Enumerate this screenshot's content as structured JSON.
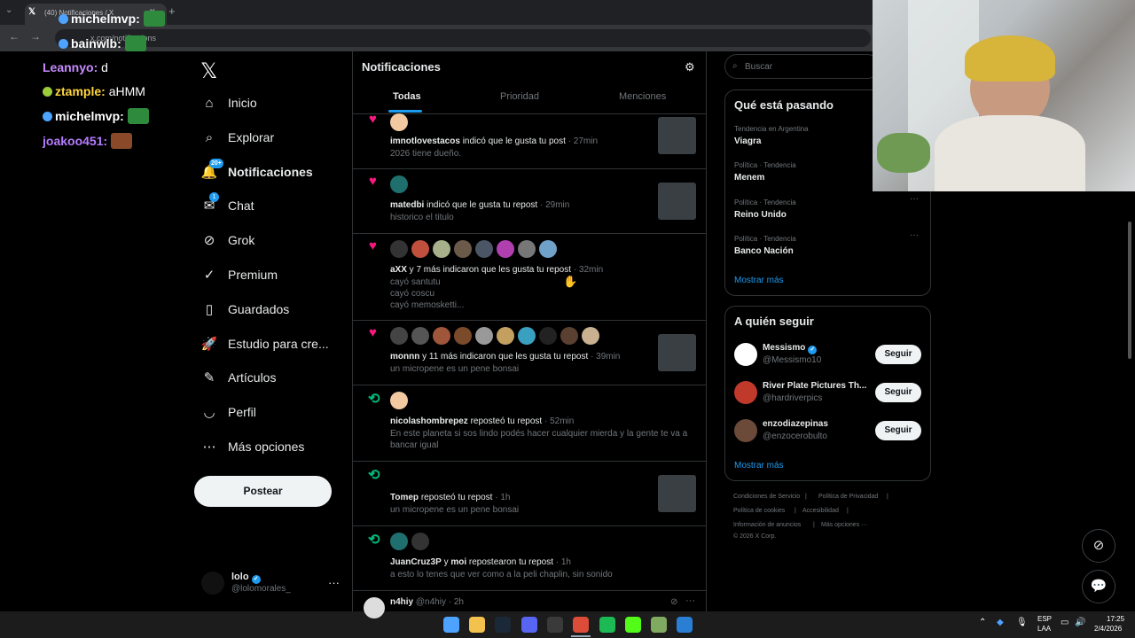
{
  "browser": {
    "tab_title": "(40) Notificaciones / X",
    "url": "x.com/notifications"
  },
  "chat": [
    {
      "user": "michelmvp",
      "sep": ":",
      "text": "",
      "color": "#ffffff"
    },
    {
      "user": "bainwlb",
      "sep": ":",
      "text": "",
      "color": "#ffffff"
    },
    {
      "user": "Leannyo",
      "sep": ": ",
      "text": "d",
      "color": "#c78bff"
    },
    {
      "user": "ztample",
      "sep": ": ",
      "text": "aHMM",
      "color": "#ffd53d"
    },
    {
      "user": "michelmvp",
      "sep": ":",
      "text": "",
      "color": "#ffffff"
    },
    {
      "user": "joakoo451",
      "sep": ":",
      "text": "",
      "color": "#b57cff"
    }
  ],
  "nav": {
    "items": [
      {
        "label": "Inicio",
        "icon": "home-icon"
      },
      {
        "label": "Explorar",
        "icon": "search-icon"
      },
      {
        "label": "Notificaciones",
        "icon": "bell-icon",
        "active": true,
        "badge": "20+"
      },
      {
        "label": "Chat",
        "icon": "chat-icon",
        "badge": "1"
      },
      {
        "label": "Grok",
        "icon": "grok-icon"
      },
      {
        "label": "Premium",
        "icon": "premium-icon"
      },
      {
        "label": "Guardados",
        "icon": "bookmark-icon"
      },
      {
        "label": "Estudio para cre...",
        "icon": "rocket-icon"
      },
      {
        "label": "Artículos",
        "icon": "article-icon"
      },
      {
        "label": "Perfil",
        "icon": "person-icon"
      },
      {
        "label": "Más opciones",
        "icon": "more-circle-icon"
      }
    ],
    "post_label": "Postear",
    "profile_name": "lolo",
    "profile_handle": "@lolomorales_",
    "more": "···"
  },
  "main": {
    "title": "Notificaciones",
    "tabs": [
      "Todas",
      "Prioridad",
      "Menciones"
    ],
    "notifications": [
      {
        "type": "like",
        "user": "imnotlovestacos",
        "action": " indicó que le gusta tu post",
        "time": " · 27min",
        "sub": "2026 tiene dueño."
      },
      {
        "type": "like",
        "user": "matedbi",
        "action": " indicó que le gusta tu repost",
        "time": " · 29min",
        "sub": "historico el titulo"
      },
      {
        "type": "like",
        "user": "aXX",
        "action": " y 7 más indicaron que les gusta tu repost",
        "time": " · 32min",
        "sub": "cayó santutu\ncayó coscu\ncayó memosketti..."
      },
      {
        "type": "like",
        "user": "monnn",
        "action": " y 11 más indicaron que les gusta tu repost",
        "time": " · 39min",
        "sub": "un micropene es un pene bonsai"
      },
      {
        "type": "repost",
        "user": "nicolashombrepez",
        "action": " reposteó tu repost",
        "time": " · 52min",
        "sub": "En este planeta si sos lindo podés hacer cualquier mierda y la gente te va a bancar igual"
      },
      {
        "type": "repost",
        "user": "Tomep",
        "action": " reposteó tu repost",
        "time": " · 1h",
        "sub": "un micropene es un pene bonsai"
      },
      {
        "type": "repost",
        "user": "JuanCruz3P",
        "action": " y ",
        "user2": "moi",
        "action2": " repostearon tu repost",
        "time": " · 1h",
        "sub": "a esto lo tenes que ver como a la peli chaplin, sin sonido"
      },
      {
        "type": "post",
        "user": "n4hiy",
        "action": " @n4hiy",
        "time": " · 2h",
        "sub": ""
      }
    ]
  },
  "right": {
    "search_placeholder": "Buscar",
    "trends_title": "Qué está pasando",
    "trends": [
      {
        "ctx": "Tendencia en Argentina",
        "name": "Viagra"
      },
      {
        "ctx": "Política · Tendencia",
        "name": "Menem"
      },
      {
        "ctx": "Política · Tendencia",
        "name": "Reino Unido"
      },
      {
        "ctx": "Política · Tendencia",
        "name": "Banco Nación"
      }
    ],
    "show_more": "Mostrar más",
    "follow_title": "A quién seguir",
    "follow": [
      {
        "name": "Messismo",
        "handle": "@Messismo10",
        "button": "Seguir"
      },
      {
        "name": "River Plate Pictures Th...",
        "handle": "@hardriverpics",
        "button": "Seguir"
      },
      {
        "name": "enzodiazepinas",
        "handle": "@enzocerobulto",
        "button": "Seguir"
      }
    ],
    "footer": [
      "Condiciones de Servicio",
      "|",
      "Política de Privacidad",
      "|",
      "Política de cookies",
      "|",
      "Accesibilidad",
      "|",
      "Información de anuncios",
      "|",
      "Más opciones ···",
      "© 2026 X Corp."
    ]
  },
  "taskbar": {
    "lang1": "ESP",
    "lang2": "LAA",
    "time": "17:25",
    "date": "2/4/2026"
  },
  "colors": {
    "accent": "#1d9bf0",
    "like": "#f91880",
    "repost": "#00ba7c"
  }
}
